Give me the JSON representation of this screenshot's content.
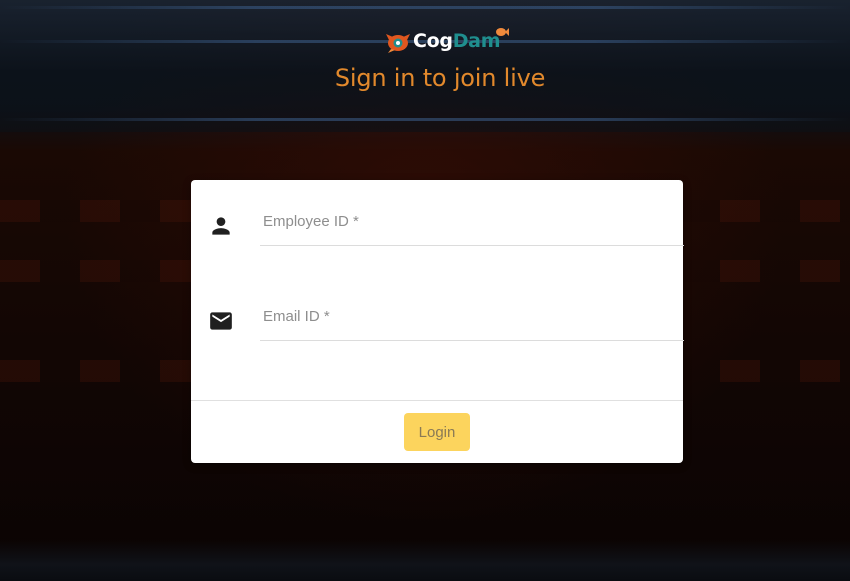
{
  "brand": {
    "logo_word_1": "Cog",
    "logo_word_2": "Dam",
    "accent_color": "#e2892c",
    "logo_teal": "#1f8e8e"
  },
  "page": {
    "heading": "Sign in to join live"
  },
  "form": {
    "employee_id": {
      "label": "Employee ID",
      "required_mark": " *",
      "value": "",
      "icon": "person-icon"
    },
    "email_id": {
      "label": "Email ID",
      "required_mark": " *",
      "value": "",
      "icon": "mail-icon"
    },
    "login_button": {
      "label": "Login",
      "color": "#fcd45d"
    }
  }
}
